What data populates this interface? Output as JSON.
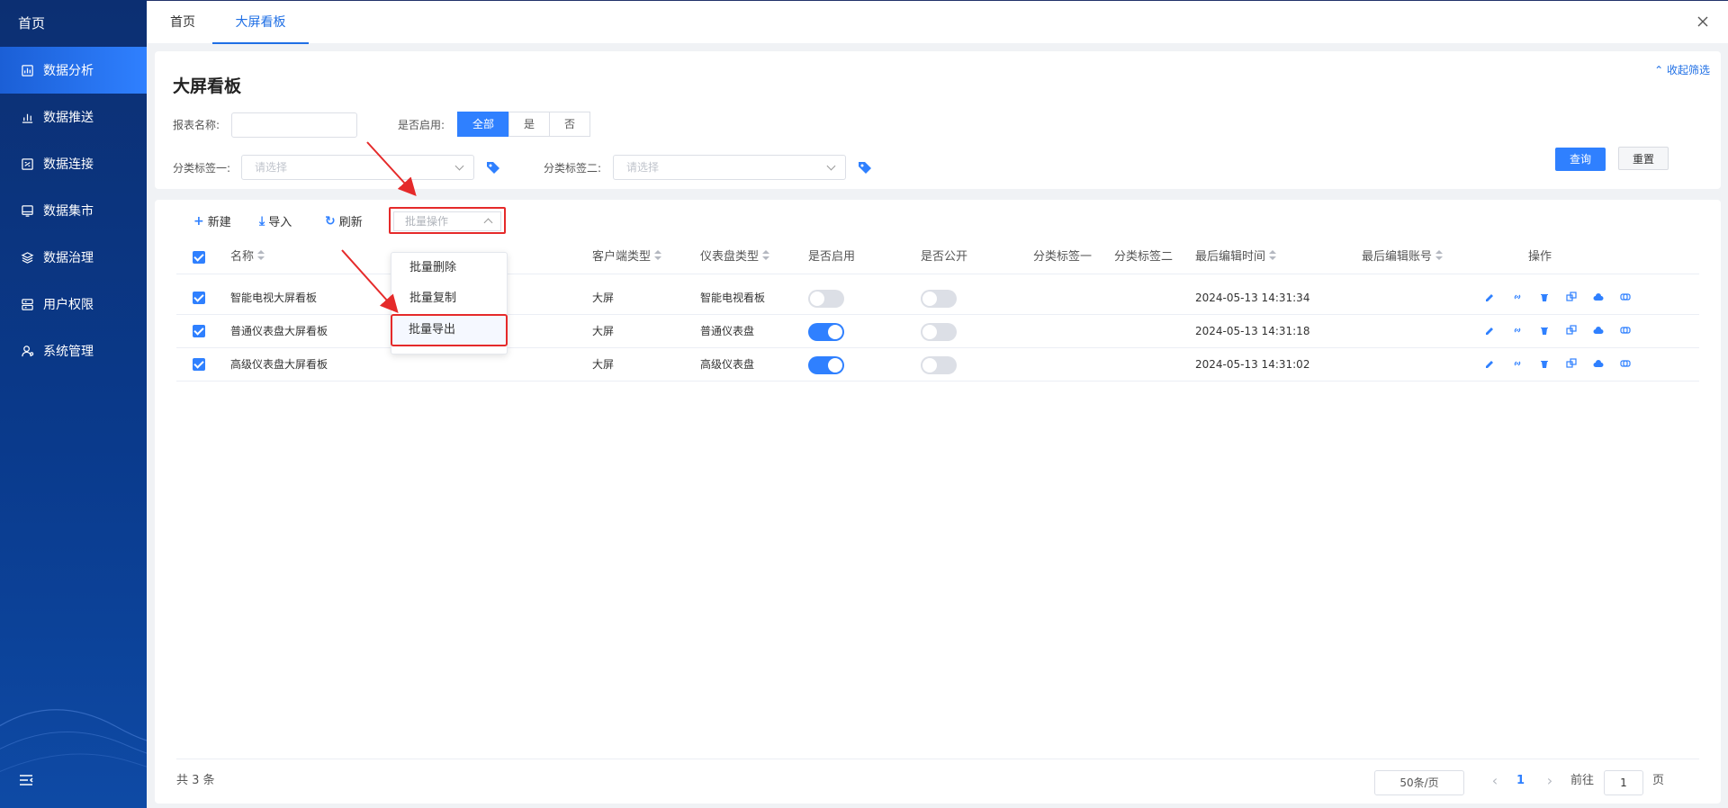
{
  "sidebar": {
    "home": "首页",
    "items": [
      {
        "label": "数据分析",
        "icon": "chart-icon"
      },
      {
        "label": "数据推送",
        "icon": "bar-chart-icon"
      },
      {
        "label": "数据连接",
        "icon": "connection-icon"
      },
      {
        "label": "数据集市",
        "icon": "monitor-icon"
      },
      {
        "label": "数据治理",
        "icon": "layers-icon"
      },
      {
        "label": "用户权限",
        "icon": "server-icon"
      },
      {
        "label": "系统管理",
        "icon": "user-settings-icon"
      }
    ]
  },
  "tabs": {
    "home": "首页",
    "board": "大屏看板"
  },
  "filter": {
    "title": "大屏看板",
    "collapse": "收起筛选",
    "report_name_label": "报表名称:",
    "enabled_label": "是否启用:",
    "seg_all": "全部",
    "seg_yes": "是",
    "seg_no": "否",
    "tag1_label": "分类标签一:",
    "tag2_label": "分类标签二:",
    "select_placeholder": "请选择",
    "query": "查询",
    "reset": "重置"
  },
  "toolbar": {
    "new": "新建",
    "import": "导入",
    "refresh": "刷新",
    "batch": "批量操作"
  },
  "dropdown": [
    "批量删除",
    "批量复制",
    "批量导出"
  ],
  "columns": {
    "name": "名称",
    "client": "客户端类型",
    "dash": "仪表盘类型",
    "enabled": "是否启用",
    "public": "是否公开",
    "tag1": "分类标签一",
    "tag2": "分类标签二",
    "edit_time": "最后编辑时间",
    "edit_acct": "最后编辑账号",
    "ops": "操作"
  },
  "rows": [
    {
      "name": "智能电视大屏看板",
      "client": "大屏",
      "dash": "智能电视看板",
      "enabled": false,
      "public": false,
      "edit_time": "2024-05-13 14:31:34"
    },
    {
      "name": "普通仪表盘大屏看板",
      "client": "大屏",
      "dash": "普通仪表盘",
      "enabled": true,
      "public": false,
      "edit_time": "2024-05-13 14:31:18"
    },
    {
      "name": "高级仪表盘大屏看板",
      "client": "大屏",
      "dash": "高级仪表盘",
      "enabled": true,
      "public": false,
      "edit_time": "2024-05-13 14:31:02"
    }
  ],
  "footer": {
    "total": "共 3 条",
    "page_size": "50条/页",
    "current": "1",
    "goto_prefix": "前往",
    "goto_value": "1",
    "goto_suffix": "页"
  },
  "colors": {
    "accent": "#2f80ff",
    "highlight": "#e52a2a",
    "sidebar": "#0a3a8c"
  }
}
